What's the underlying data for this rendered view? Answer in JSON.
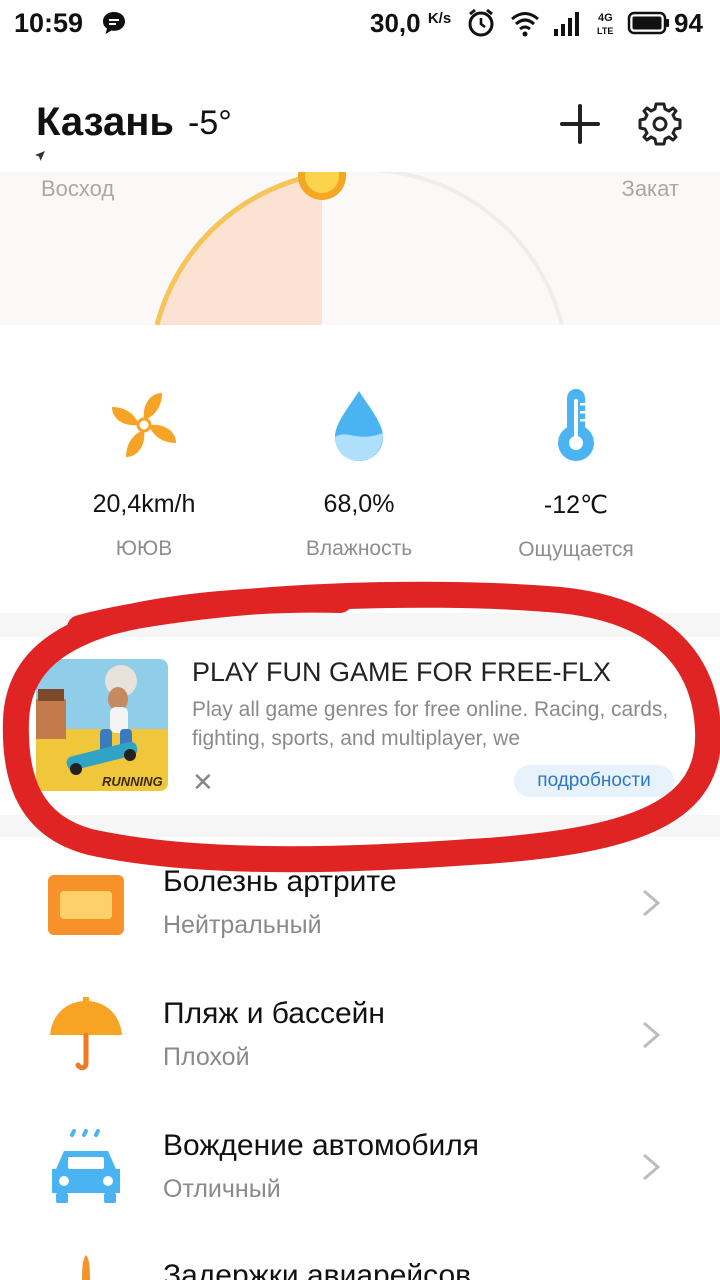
{
  "status_bar": {
    "time": "10:59",
    "speed": "30,0",
    "speed_unit": "K/s",
    "network_top": "4G",
    "network_bottom": "LTE",
    "battery": "94"
  },
  "header": {
    "city": "Казань",
    "temperature": "-5°"
  },
  "sun": {
    "sunrise_label": "Восход",
    "sunset_label": "Закат"
  },
  "metrics": [
    {
      "icon": "fan-icon",
      "value": "20,4km/h",
      "label": "ЮЮВ"
    },
    {
      "icon": "water-drop-icon",
      "value": "68,0%",
      "label": "Влажность"
    },
    {
      "icon": "thermometer-icon",
      "value": "-12℃",
      "label": "Ощущается"
    }
  ],
  "ad": {
    "title": "PLAY FUN GAME FOR FREE-FLX",
    "description": "Play all game genres for free online. Racing, cards, fighting, sports, and multiplayer, we",
    "image_caption": "RUNNING",
    "close_symbol": "✕",
    "more_label": "подробности"
  },
  "activities": [
    {
      "icon": "ticket-icon",
      "name": "Болезнь артрите",
      "status": "Нейтральный"
    },
    {
      "icon": "umbrella-icon",
      "name": "Пляж и бассейн",
      "status": "Плохой"
    },
    {
      "icon": "car-icon",
      "name": "Вождение автомобиля",
      "status": "Отличный"
    },
    {
      "icon": "plane-icon",
      "name": "Задержки авиарейсов",
      "status": ""
    }
  ],
  "colors": {
    "accent_orange": "#f5a623",
    "blue": "#4ab4f2",
    "annotation_red": "#e02424"
  }
}
